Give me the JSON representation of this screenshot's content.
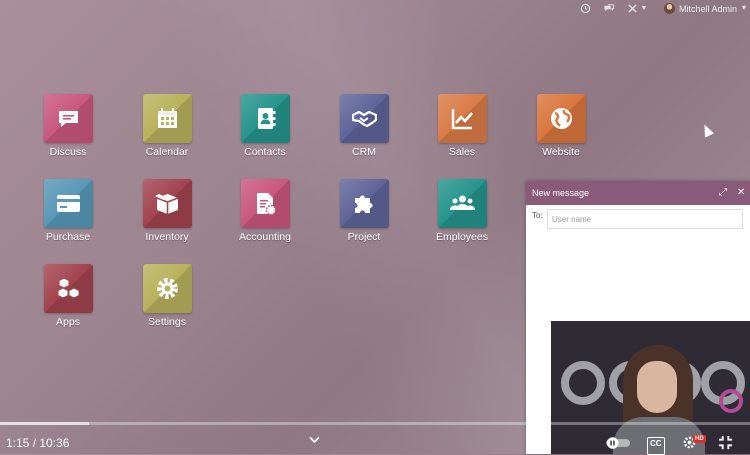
{
  "topbar": {
    "icons": [
      "clock-icon",
      "chat-icon",
      "tools-icon",
      "caret-down-icon"
    ],
    "user_name": "Mitchell Admin"
  },
  "apps": [
    {
      "id": "discuss",
      "label": "Discuss",
      "color": "#c9577d",
      "icon": "speech-bubble-icon"
    },
    {
      "id": "calendar",
      "label": "Calendar",
      "color": "#b8b25d",
      "icon": "calendar-icon"
    },
    {
      "id": "contacts",
      "label": "Contacts",
      "color": "#26948d",
      "icon": "address-book-icon"
    },
    {
      "id": "crm",
      "label": "CRM",
      "color": "#5e6499",
      "icon": "handshake-icon"
    },
    {
      "id": "sales",
      "label": "Sales",
      "color": "#d97b46",
      "icon": "chart-line-icon"
    },
    {
      "id": "website",
      "label": "Website",
      "color": "#d9763e",
      "icon": "globe-icon"
    },
    {
      "id": "purchase",
      "label": "Purchase",
      "color": "#5898b8",
      "icon": "credit-card-icon"
    },
    {
      "id": "inventory",
      "label": "Inventory",
      "color": "#a2434f",
      "icon": "box-icon"
    },
    {
      "id": "accounting",
      "label": "Accounting",
      "color": "#c9577d",
      "icon": "document-gear-icon"
    },
    {
      "id": "project",
      "label": "Project",
      "color": "#5e6499",
      "icon": "puzzle-icon"
    },
    {
      "id": "employees",
      "label": "Employees",
      "color": "#26948d",
      "icon": "people-icon"
    },
    {
      "id": "apps",
      "label": "Apps",
      "color": "#a2434f",
      "icon": "cubes-icon"
    },
    {
      "id": "settings",
      "label": "Settings",
      "color": "#b8b25d",
      "icon": "gear-icon"
    }
  ],
  "message": {
    "title": "New message",
    "to_label": "To:",
    "placeholder": "User name",
    "header_color": "#8a5a7a"
  },
  "video": {
    "time": "1:15 / 10:36",
    "progress": 0.118,
    "cc_label": "CC",
    "hd_label": "HD"
  }
}
